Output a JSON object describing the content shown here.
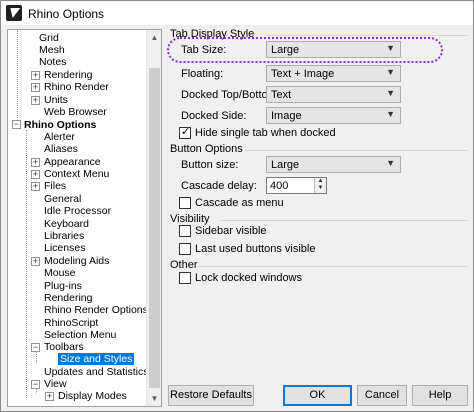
{
  "window": {
    "title": "Rhino Options"
  },
  "tree": {
    "items": [
      {
        "label": "Grid"
      },
      {
        "label": "Mesh"
      },
      {
        "label": "Notes"
      },
      {
        "label": "Rendering"
      },
      {
        "label": "Rhino Render"
      },
      {
        "label": "Units"
      },
      {
        "label": "Web Browser"
      },
      {
        "label": "Rhino Options"
      },
      {
        "label": "Alerter"
      },
      {
        "label": "Aliases"
      },
      {
        "label": "Appearance"
      },
      {
        "label": "Context Menu"
      },
      {
        "label": "Files"
      },
      {
        "label": "General"
      },
      {
        "label": "Idle Processor"
      },
      {
        "label": "Keyboard"
      },
      {
        "label": "Libraries"
      },
      {
        "label": "Licenses"
      },
      {
        "label": "Modeling Aids"
      },
      {
        "label": "Mouse"
      },
      {
        "label": "Plug-ins"
      },
      {
        "label": "Rendering"
      },
      {
        "label": "Rhino Render Options"
      },
      {
        "label": "RhinoScript"
      },
      {
        "label": "Selection Menu"
      },
      {
        "label": "Toolbars"
      },
      {
        "label": "Size and Styles"
      },
      {
        "label": "Updates and Statistics"
      },
      {
        "label": "View"
      },
      {
        "label": "Display Modes"
      }
    ],
    "expander_plus": "+",
    "expander_minus": "−"
  },
  "tab_display": {
    "title": "Tab Display Style",
    "tab_size_label": "Tab Size:",
    "tab_size_value": "Large",
    "floating_label": "Floating:",
    "floating_value": "Text + Image",
    "docked_tb_label": "Docked Top/Bottom:",
    "docked_tb_value": "Text",
    "docked_side_label": "Docked Side:",
    "docked_side_value": "Image",
    "hide_single_label": "Hide single tab when docked",
    "hide_single_checked": true
  },
  "button_options": {
    "title": "Button Options",
    "button_size_label": "Button size:",
    "button_size_value": "Large",
    "cascade_delay_label": "Cascade delay:",
    "cascade_delay_value": "400",
    "cascade_menu_label": "Cascade as menu",
    "cascade_menu_checked": false
  },
  "visibility": {
    "title": "Visibility",
    "sidebar_label": "Sidebar visible",
    "sidebar_checked": false,
    "last_used_label": "Last used buttons visible",
    "last_used_checked": false
  },
  "other": {
    "title": "Other",
    "lock_label": "Lock docked windows",
    "lock_checked": false
  },
  "buttons": {
    "restore": "Restore Defaults",
    "ok": "OK",
    "cancel": "Cancel",
    "help": "Help"
  },
  "icons": {
    "dropdown": "▼",
    "spin_up": "▲",
    "spin_down": "▼",
    "scroll_up": "▲",
    "scroll_down": "▼"
  },
  "colors": {
    "selection": "#0078d7",
    "highlight_outline": "#8b2fc9"
  }
}
